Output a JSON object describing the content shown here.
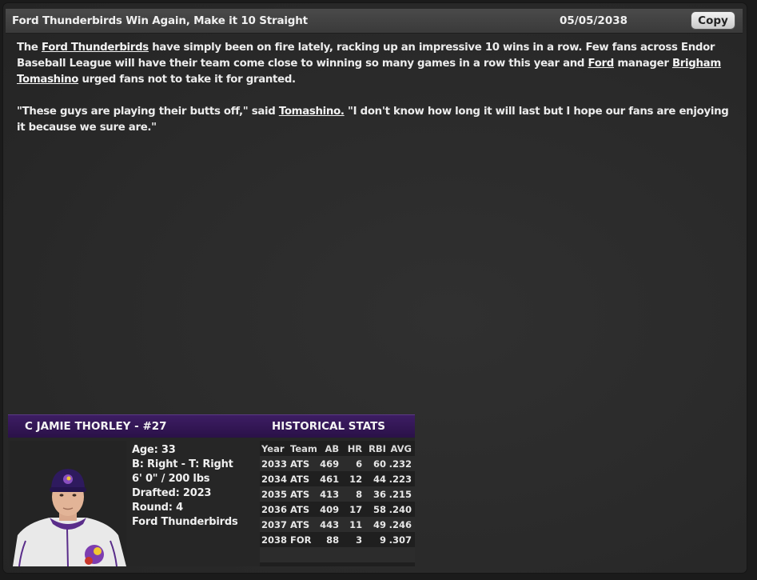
{
  "news": {
    "title": "Ford Thunderbirds Win Again, Make it 10 Straight",
    "date": "05/05/2038",
    "copy_label": "Copy",
    "p1": {
      "t1": "The ",
      "l1": "Ford Thunderbirds",
      "t2": " have simply been on fire lately, racking up an impressive 10 wins in a row. Few fans across Endor Baseball League will have their team come close to winning so many games in a row this year and ",
      "l2": "Ford",
      "t3": " manager ",
      "l3": "Brigham Tomashino",
      "t4": " urged fans not to take it for granted."
    },
    "p2": {
      "t1": "\"These guys are playing their butts off,\" said ",
      "l1": "Tomashino.",
      "t2": " \"I don't know how long it will last but I hope our fans are enjoying it because we sure are.\""
    }
  },
  "player": {
    "header": "C JAMIE THORLEY - #27",
    "stats_header": "HISTORICAL STATS",
    "age": "Age: 33",
    "bats_throws": "B: Right - T: Right",
    "height_weight": "6' 0\" / 200 lbs",
    "drafted": "Drafted: 2023",
    "round": "Round: 4",
    "team": "Ford Thunderbirds",
    "colors": {
      "cap": "#2e1a5e",
      "jersey": "#e9e9e9",
      "trim": "#5a2d8a"
    }
  },
  "stats": {
    "columns": [
      "Year",
      "Team",
      "AB",
      "HR",
      "RBI",
      "AVG"
    ],
    "rows": [
      [
        "2033",
        "ATS",
        "469",
        "6",
        "60",
        ".232"
      ],
      [
        "2034",
        "ATS",
        "461",
        "12",
        "44",
        ".223"
      ],
      [
        "2035",
        "ATS",
        "413",
        "8",
        "36",
        ".215"
      ],
      [
        "2036",
        "ATS",
        "409",
        "17",
        "58",
        ".240"
      ],
      [
        "2037",
        "ATS",
        "443",
        "11",
        "49",
        ".246"
      ],
      [
        "2038",
        "FOR",
        "88",
        "3",
        "9",
        ".307"
      ]
    ]
  }
}
